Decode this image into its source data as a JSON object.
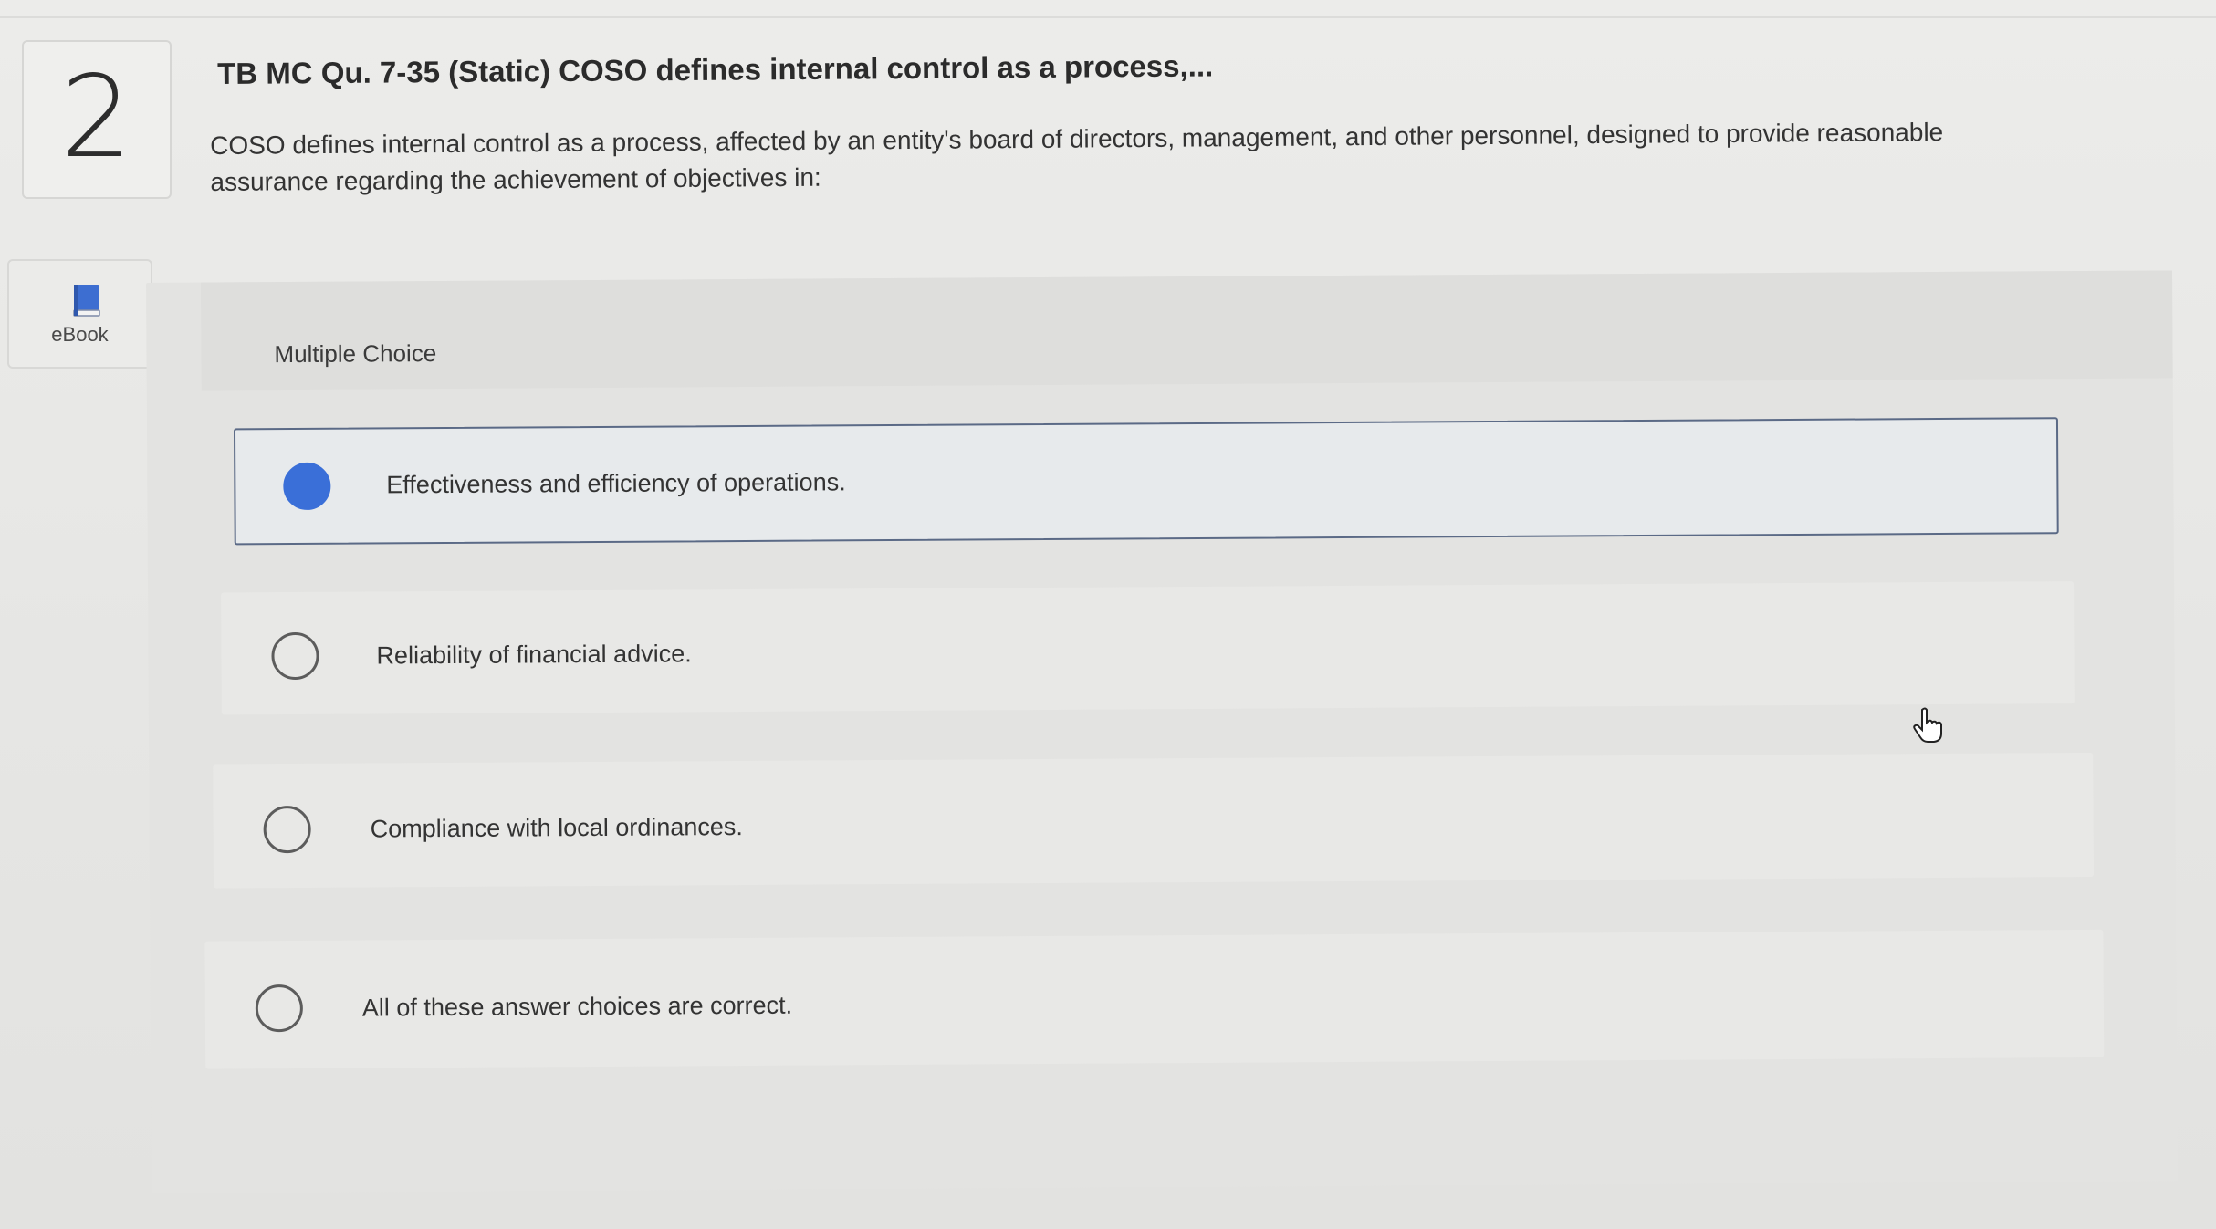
{
  "question": {
    "number": "2",
    "title": "TB MC Qu. 7-35 (Static) COSO defines internal control as a process,...",
    "text": "COSO defines internal control as a process, affected by an entity's board of directors, management, and other personnel, designed to provide reasonable assurance regarding the achievement of objectives in:"
  },
  "sidebar": {
    "ebook_label": "eBook",
    "ebook_icon": "book-icon"
  },
  "answer_panel": {
    "type_label": "Multiple Choice",
    "options": [
      {
        "label": "Effectiveness and efficiency of operations.",
        "selected": true
      },
      {
        "label": "Reliability of financial advice.",
        "selected": false
      },
      {
        "label": "Compliance with local ordinances.",
        "selected": false
      },
      {
        "label": "All of these answer choices are correct.",
        "selected": false
      }
    ]
  },
  "colors": {
    "selected_radio": "#3a6fd8",
    "selected_border": "#5b6a86"
  }
}
